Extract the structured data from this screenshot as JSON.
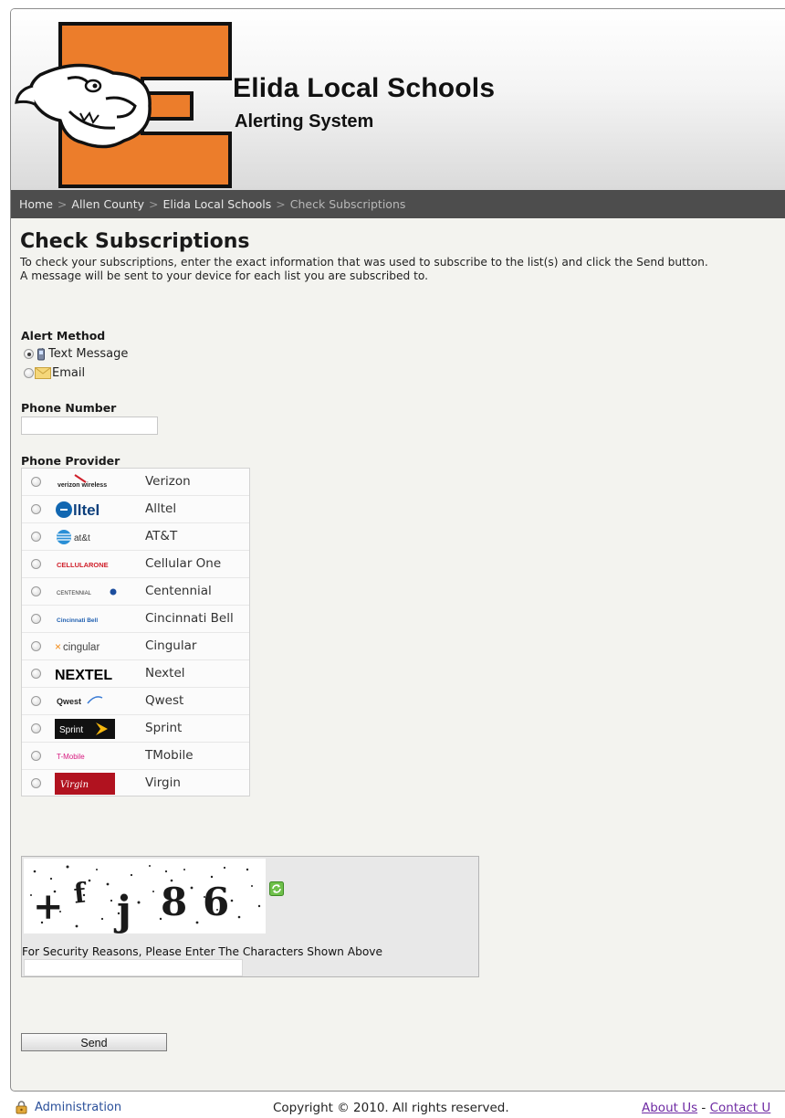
{
  "header": {
    "title": "Elida Local Schools",
    "subtitle": "Alerting System"
  },
  "breadcrumb": [
    {
      "label": "Home"
    },
    {
      "label": "Allen County"
    },
    {
      "label": "Elida Local Schools"
    },
    {
      "label": "Check Subscriptions",
      "current": true
    }
  ],
  "main": {
    "title": "Check Subscriptions",
    "intro_line1": "To check your subscriptions, enter the exact information that was used to subscribe to the list(s) and click the Send button.",
    "intro_line2": "A message will be sent to your device for each list you are subscribed to."
  },
  "alert_method": {
    "label": "Alert Method",
    "options": [
      {
        "label": "Text Message",
        "icon": "phone-icon",
        "selected": true
      },
      {
        "label": "Email",
        "icon": "envelope-icon",
        "selected": false
      }
    ]
  },
  "phone_number": {
    "label": "Phone Number",
    "value": ""
  },
  "phone_provider": {
    "label": "Phone Provider",
    "providers": [
      {
        "name": "Verizon",
        "logo": "verizon-logo"
      },
      {
        "name": "Alltel",
        "logo": "alltel-logo"
      },
      {
        "name": "AT&T",
        "logo": "att-logo"
      },
      {
        "name": "Cellular One",
        "logo": "cellular-one-logo"
      },
      {
        "name": "Centennial",
        "logo": "centennial-logo"
      },
      {
        "name": "Cincinnati Bell",
        "logo": "cincinnati-bell-logo"
      },
      {
        "name": "Cingular",
        "logo": "cingular-logo"
      },
      {
        "name": "Nextel",
        "logo": "nextel-logo"
      },
      {
        "name": "Qwest",
        "logo": "qwest-logo"
      },
      {
        "name": "Sprint",
        "logo": "sprint-logo"
      },
      {
        "name": "TMobile",
        "logo": "tmobile-logo"
      },
      {
        "name": "Virgin",
        "logo": "virgin-logo"
      }
    ]
  },
  "logo_text": {
    "verizon": "verizon wireless",
    "alltel": "lltel",
    "att": "at&t",
    "cellular_one": "CELLULARONE",
    "centennial": "CENTENNIAL",
    "cincinnati_bell": "Cincinnati Bell",
    "cingular": "cingular",
    "nextel": "NEXTEL",
    "qwest": "Qwest",
    "sprint": "Sprint",
    "tmobile": "T-Mobile",
    "virgin": "Virgin"
  },
  "captcha": {
    "characters": "+fj86",
    "prompt": "For Security Reasons, Please Enter The Characters Shown Above",
    "value": ""
  },
  "send_label": "Send",
  "footer": {
    "admin_label": "Administration",
    "copyright": "Copyright © 2010. All rights reserved.",
    "about": "About Us",
    "separator": "-",
    "contact": "Contact U"
  },
  "colors": {
    "brand_orange": "#ec7d2b",
    "breadcrumb_bg": "#4d4d4d",
    "link_blue": "#2a4f9a",
    "link_visited": "#6e2aa3"
  }
}
